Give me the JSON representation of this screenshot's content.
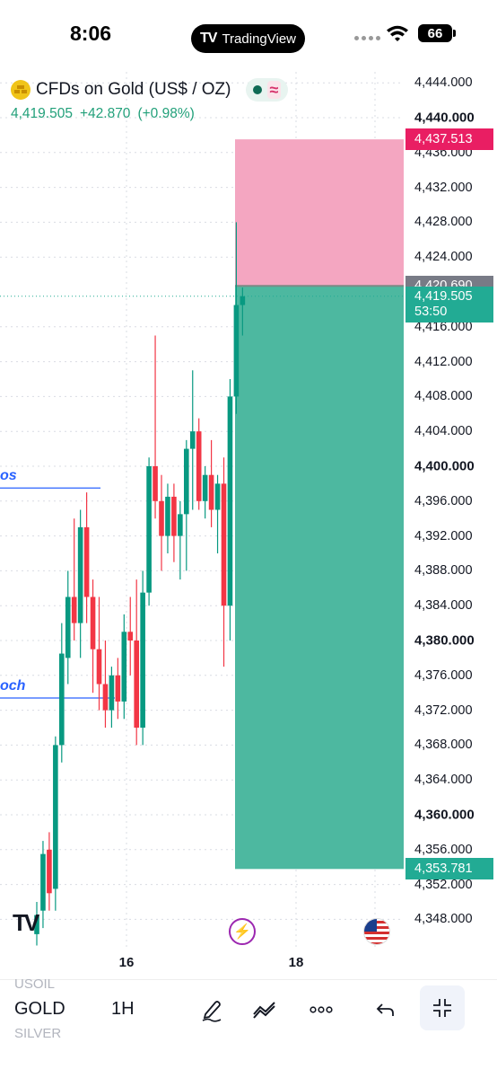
{
  "status_bar": {
    "time": "8:06",
    "app_pill": "TradingView",
    "battery": "66"
  },
  "symbol": {
    "title": "CFDs on Gold (US$ / OZ)",
    "last": "4,419.505",
    "change": "+42.870",
    "change_pct": "(+0.98%)"
  },
  "price_scale": {
    "ticks": [
      {
        "label": "4,444.000",
        "value": 4444,
        "bold": false
      },
      {
        "label": "4,440.000",
        "value": 4440,
        "bold": true
      },
      {
        "label": "4,436.000",
        "value": 4436,
        "bold": false
      },
      {
        "label": "4,432.000",
        "value": 4432,
        "bold": false
      },
      {
        "label": "4,428.000",
        "value": 4428,
        "bold": false
      },
      {
        "label": "4,424.000",
        "value": 4424,
        "bold": false
      },
      {
        "label": "4,416.000",
        "value": 4416,
        "bold": false
      },
      {
        "label": "4,412.000",
        "value": 4412,
        "bold": false
      },
      {
        "label": "4,408.000",
        "value": 4408,
        "bold": false
      },
      {
        "label": "4,404.000",
        "value": 4404,
        "bold": false
      },
      {
        "label": "4,400.000",
        "value": 4400,
        "bold": true
      },
      {
        "label": "4,396.000",
        "value": 4396,
        "bold": false
      },
      {
        "label": "4,392.000",
        "value": 4392,
        "bold": false
      },
      {
        "label": "4,388.000",
        "value": 4388,
        "bold": false
      },
      {
        "label": "4,384.000",
        "value": 4384,
        "bold": false
      },
      {
        "label": "4,380.000",
        "value": 4380,
        "bold": true
      },
      {
        "label": "4,376.000",
        "value": 4376,
        "bold": false
      },
      {
        "label": "4,372.000",
        "value": 4372,
        "bold": false
      },
      {
        "label": "4,368.000",
        "value": 4368,
        "bold": false
      },
      {
        "label": "4,364.000",
        "value": 4364,
        "bold": false
      },
      {
        "label": "4,360.000",
        "value": 4360,
        "bold": true
      },
      {
        "label": "4,356.000",
        "value": 4356,
        "bold": false
      },
      {
        "label": "4,352.000",
        "value": 4352,
        "bold": false
      },
      {
        "label": "4,348.000",
        "value": 4348,
        "bold": false
      }
    ],
    "labels": {
      "stop_loss": {
        "text": "4,437.513",
        "value": 4437.513,
        "color": "#e91e63"
      },
      "entry": {
        "text": "4,420.690",
        "value": 4420.69,
        "color": "#787b86"
      },
      "current": {
        "text": "4,419.505",
        "countdown": "53:50",
        "value": 4419.505,
        "color": "#22ab94"
      },
      "take_profit": {
        "text": "4,353.781",
        "value": 4353.781,
        "color": "#22ab94"
      }
    }
  },
  "time_axis": {
    "ticks": [
      {
        "label": "16",
        "index": 16
      },
      {
        "label": "18",
        "index": 43
      }
    ]
  },
  "annotations": {
    "upper": {
      "text": "os",
      "price": 4397.5
    },
    "lower": {
      "text": "och",
      "price": 4373.4
    }
  },
  "chart_data": {
    "type": "candlestick",
    "timeframe": "1H",
    "ylim": [
      4346,
      4448
    ],
    "up_color": "#089981",
    "down_color": "#f23645",
    "candles": [
      {
        "o": 4346.3,
        "h": 4350.0,
        "l": 4345.0,
        "c": 4348.5
      },
      {
        "o": 4349.0,
        "h": 4357.0,
        "l": 4347.0,
        "c": 4355.5
      },
      {
        "o": 4356.0,
        "h": 4358.0,
        "l": 4349.0,
        "c": 4351.0
      },
      {
        "o": 4351.5,
        "h": 4369.0,
        "l": 4349.0,
        "c": 4368.0
      },
      {
        "o": 4368.0,
        "h": 4382.0,
        "l": 4366.0,
        "c": 4378.5
      },
      {
        "o": 4378.0,
        "h": 4388.0,
        "l": 4375.0,
        "c": 4385.0
      },
      {
        "o": 4385.0,
        "h": 4394.0,
        "l": 4380.0,
        "c": 4382.0
      },
      {
        "o": 4382.0,
        "h": 4395.0,
        "l": 4378.0,
        "c": 4393.0
      },
      {
        "o": 4393.0,
        "h": 4397.0,
        "l": 4382.0,
        "c": 4385.0
      },
      {
        "o": 4385.0,
        "h": 4387.0,
        "l": 4374.0,
        "c": 4379.0
      },
      {
        "o": 4379.0,
        "h": 4385.0,
        "l": 4372.0,
        "c": 4375.0
      },
      {
        "o": 4375.0,
        "h": 4380.0,
        "l": 4370.0,
        "c": 4372.0
      },
      {
        "o": 4372.0,
        "h": 4377.0,
        "l": 4370.0,
        "c": 4376.0
      },
      {
        "o": 4376.0,
        "h": 4378.0,
        "l": 4371.0,
        "c": 4373.0
      },
      {
        "o": 4373.0,
        "h": 4383.0,
        "l": 4371.0,
        "c": 4381.0
      },
      {
        "o": 4381.0,
        "h": 4385.0,
        "l": 4376.0,
        "c": 4380.0
      },
      {
        "o": 4380.0,
        "h": 4387.0,
        "l": 4368.0,
        "c": 4370.0
      },
      {
        "o": 4370.0,
        "h": 4388.0,
        "l": 4368.0,
        "c": 4385.5
      },
      {
        "o": 4385.5,
        "h": 4401.0,
        "l": 4384.0,
        "c": 4400.0
      },
      {
        "o": 4400.0,
        "h": 4415.0,
        "l": 4394.0,
        "c": 4396.0
      },
      {
        "o": 4396.0,
        "h": 4399.0,
        "l": 4388.0,
        "c": 4392.0
      },
      {
        "o": 4392.0,
        "h": 4398.0,
        "l": 4390.0,
        "c": 4396.5
      },
      {
        "o": 4396.5,
        "h": 4398.0,
        "l": 4389.0,
        "c": 4392.0
      },
      {
        "o": 4392.0,
        "h": 4396.0,
        "l": 4387.0,
        "c": 4394.5
      },
      {
        "o": 4394.5,
        "h": 4403.0,
        "l": 4388.0,
        "c": 4402.0
      },
      {
        "o": 4402.0,
        "h": 4411.0,
        "l": 4395.0,
        "c": 4404.0
      },
      {
        "o": 4404.0,
        "h": 4405.5,
        "l": 4395.0,
        "c": 4396.0
      },
      {
        "o": 4396.0,
        "h": 4400.0,
        "l": 4394.0,
        "c": 4399.0
      },
      {
        "o": 4399.0,
        "h": 4403.0,
        "l": 4393.0,
        "c": 4395.0
      },
      {
        "o": 4395.0,
        "h": 4399.0,
        "l": 4390.0,
        "c": 4398.0
      },
      {
        "o": 4398.0,
        "h": 4401.0,
        "l": 4377.0,
        "c": 4384.0
      },
      {
        "o": 4384.0,
        "h": 4410.0,
        "l": 4380.0,
        "c": 4408.0
      },
      {
        "o": 4408.0,
        "h": 4428.0,
        "l": 4406.0,
        "c": 4418.5
      },
      {
        "o": 4418.5,
        "h": 4420.5,
        "l": 4415.0,
        "c": 4419.505
      }
    ]
  },
  "toolbar": {
    "symbols": [
      "USOIL",
      "GOLD",
      "SILVER"
    ],
    "interval": "1H",
    "icons": [
      "pen-icon",
      "indicators-icon",
      "more-icon",
      "undo-icon",
      "collapse-icon"
    ]
  }
}
